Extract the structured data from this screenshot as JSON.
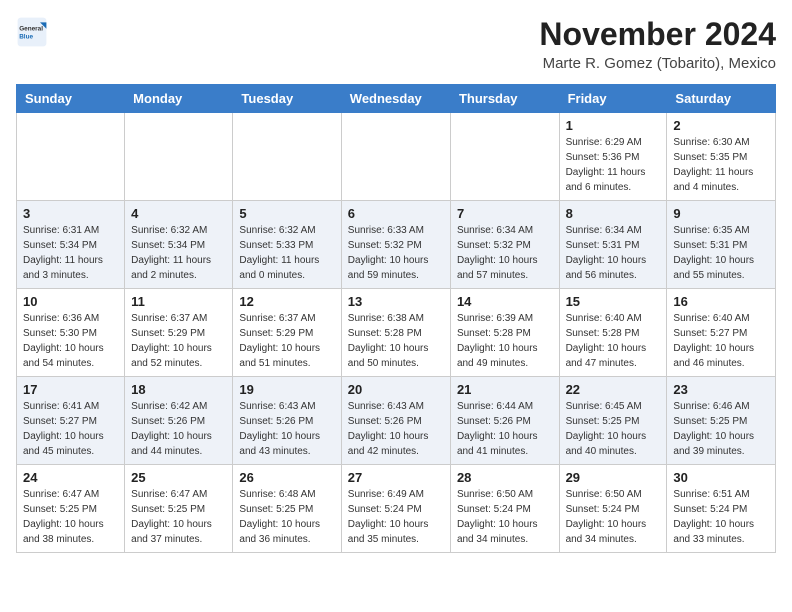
{
  "header": {
    "logo": {
      "general": "General",
      "blue": "Blue"
    },
    "month": "November 2024",
    "location": "Marte R. Gomez (Tobarito), Mexico"
  },
  "weekdays": [
    "Sunday",
    "Monday",
    "Tuesday",
    "Wednesday",
    "Thursday",
    "Friday",
    "Saturday"
  ],
  "weeks": [
    [
      {
        "day": "",
        "info": ""
      },
      {
        "day": "",
        "info": ""
      },
      {
        "day": "",
        "info": ""
      },
      {
        "day": "",
        "info": ""
      },
      {
        "day": "",
        "info": ""
      },
      {
        "day": "1",
        "info": "Sunrise: 6:29 AM\nSunset: 5:36 PM\nDaylight: 11 hours and 6 minutes."
      },
      {
        "day": "2",
        "info": "Sunrise: 6:30 AM\nSunset: 5:35 PM\nDaylight: 11 hours and 4 minutes."
      }
    ],
    [
      {
        "day": "3",
        "info": "Sunrise: 6:31 AM\nSunset: 5:34 PM\nDaylight: 11 hours and 3 minutes."
      },
      {
        "day": "4",
        "info": "Sunrise: 6:32 AM\nSunset: 5:34 PM\nDaylight: 11 hours and 2 minutes."
      },
      {
        "day": "5",
        "info": "Sunrise: 6:32 AM\nSunset: 5:33 PM\nDaylight: 11 hours and 0 minutes."
      },
      {
        "day": "6",
        "info": "Sunrise: 6:33 AM\nSunset: 5:32 PM\nDaylight: 10 hours and 59 minutes."
      },
      {
        "day": "7",
        "info": "Sunrise: 6:34 AM\nSunset: 5:32 PM\nDaylight: 10 hours and 57 minutes."
      },
      {
        "day": "8",
        "info": "Sunrise: 6:34 AM\nSunset: 5:31 PM\nDaylight: 10 hours and 56 minutes."
      },
      {
        "day": "9",
        "info": "Sunrise: 6:35 AM\nSunset: 5:31 PM\nDaylight: 10 hours and 55 minutes."
      }
    ],
    [
      {
        "day": "10",
        "info": "Sunrise: 6:36 AM\nSunset: 5:30 PM\nDaylight: 10 hours and 54 minutes."
      },
      {
        "day": "11",
        "info": "Sunrise: 6:37 AM\nSunset: 5:29 PM\nDaylight: 10 hours and 52 minutes."
      },
      {
        "day": "12",
        "info": "Sunrise: 6:37 AM\nSunset: 5:29 PM\nDaylight: 10 hours and 51 minutes."
      },
      {
        "day": "13",
        "info": "Sunrise: 6:38 AM\nSunset: 5:28 PM\nDaylight: 10 hours and 50 minutes."
      },
      {
        "day": "14",
        "info": "Sunrise: 6:39 AM\nSunset: 5:28 PM\nDaylight: 10 hours and 49 minutes."
      },
      {
        "day": "15",
        "info": "Sunrise: 6:40 AM\nSunset: 5:28 PM\nDaylight: 10 hours and 47 minutes."
      },
      {
        "day": "16",
        "info": "Sunrise: 6:40 AM\nSunset: 5:27 PM\nDaylight: 10 hours and 46 minutes."
      }
    ],
    [
      {
        "day": "17",
        "info": "Sunrise: 6:41 AM\nSunset: 5:27 PM\nDaylight: 10 hours and 45 minutes."
      },
      {
        "day": "18",
        "info": "Sunrise: 6:42 AM\nSunset: 5:26 PM\nDaylight: 10 hours and 44 minutes."
      },
      {
        "day": "19",
        "info": "Sunrise: 6:43 AM\nSunset: 5:26 PM\nDaylight: 10 hours and 43 minutes."
      },
      {
        "day": "20",
        "info": "Sunrise: 6:43 AM\nSunset: 5:26 PM\nDaylight: 10 hours and 42 minutes."
      },
      {
        "day": "21",
        "info": "Sunrise: 6:44 AM\nSunset: 5:26 PM\nDaylight: 10 hours and 41 minutes."
      },
      {
        "day": "22",
        "info": "Sunrise: 6:45 AM\nSunset: 5:25 PM\nDaylight: 10 hours and 40 minutes."
      },
      {
        "day": "23",
        "info": "Sunrise: 6:46 AM\nSunset: 5:25 PM\nDaylight: 10 hours and 39 minutes."
      }
    ],
    [
      {
        "day": "24",
        "info": "Sunrise: 6:47 AM\nSunset: 5:25 PM\nDaylight: 10 hours and 38 minutes."
      },
      {
        "day": "25",
        "info": "Sunrise: 6:47 AM\nSunset: 5:25 PM\nDaylight: 10 hours and 37 minutes."
      },
      {
        "day": "26",
        "info": "Sunrise: 6:48 AM\nSunset: 5:25 PM\nDaylight: 10 hours and 36 minutes."
      },
      {
        "day": "27",
        "info": "Sunrise: 6:49 AM\nSunset: 5:24 PM\nDaylight: 10 hours and 35 minutes."
      },
      {
        "day": "28",
        "info": "Sunrise: 6:50 AM\nSunset: 5:24 PM\nDaylight: 10 hours and 34 minutes."
      },
      {
        "day": "29",
        "info": "Sunrise: 6:50 AM\nSunset: 5:24 PM\nDaylight: 10 hours and 34 minutes."
      },
      {
        "day": "30",
        "info": "Sunrise: 6:51 AM\nSunset: 5:24 PM\nDaylight: 10 hours and 33 minutes."
      }
    ]
  ]
}
